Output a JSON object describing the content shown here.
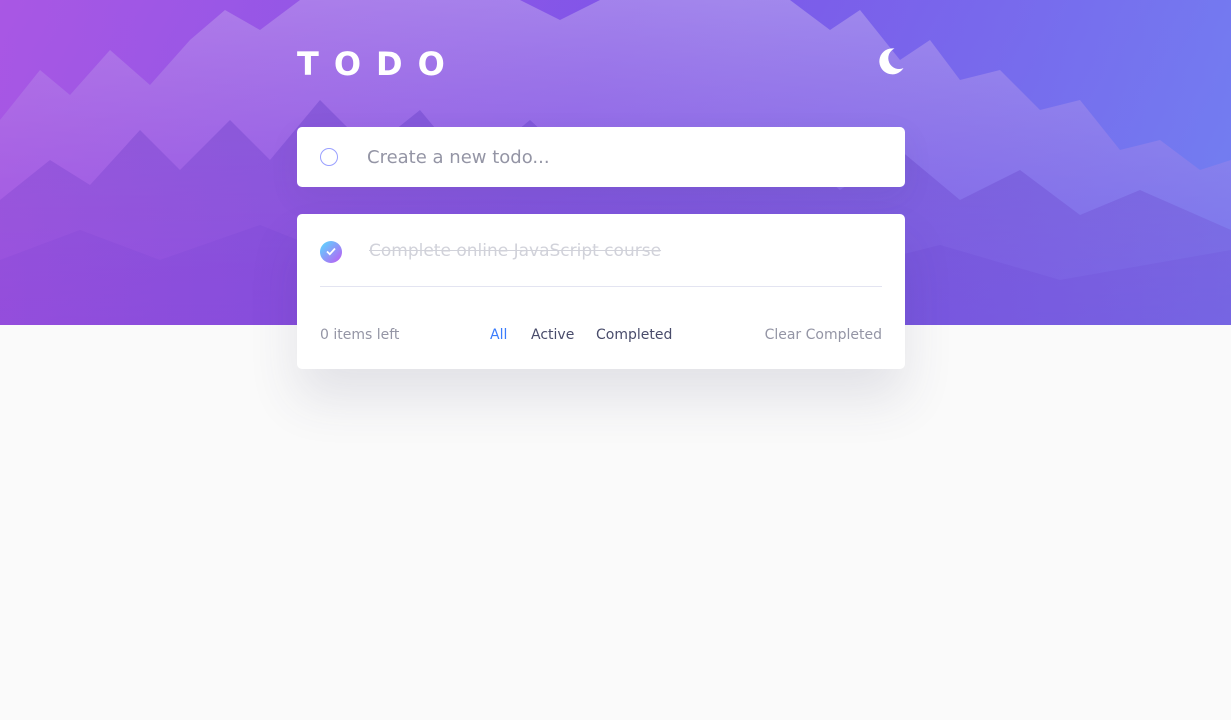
{
  "app": {
    "title": "TODO"
  },
  "colors": {
    "accent": "#3a7cfd",
    "check_gradient_start": "#55ddff",
    "check_gradient_end": "#c058f3",
    "completed_text": "#d1d2da",
    "muted_text": "#9495a5",
    "primary_text": "#494c6b"
  },
  "header": {
    "theme_toggle_icon": "moon-icon"
  },
  "new_todo": {
    "placeholder": "Create a new todo...",
    "value": ""
  },
  "todos": [
    {
      "text": "Complete online JavaScript course",
      "completed": true
    }
  ],
  "footer": {
    "items_left": "0 items left",
    "filters": [
      {
        "label": "All",
        "active": true
      },
      {
        "label": "Active",
        "active": false
      },
      {
        "label": "Completed",
        "active": false
      }
    ],
    "clear_label": "Clear Completed"
  }
}
